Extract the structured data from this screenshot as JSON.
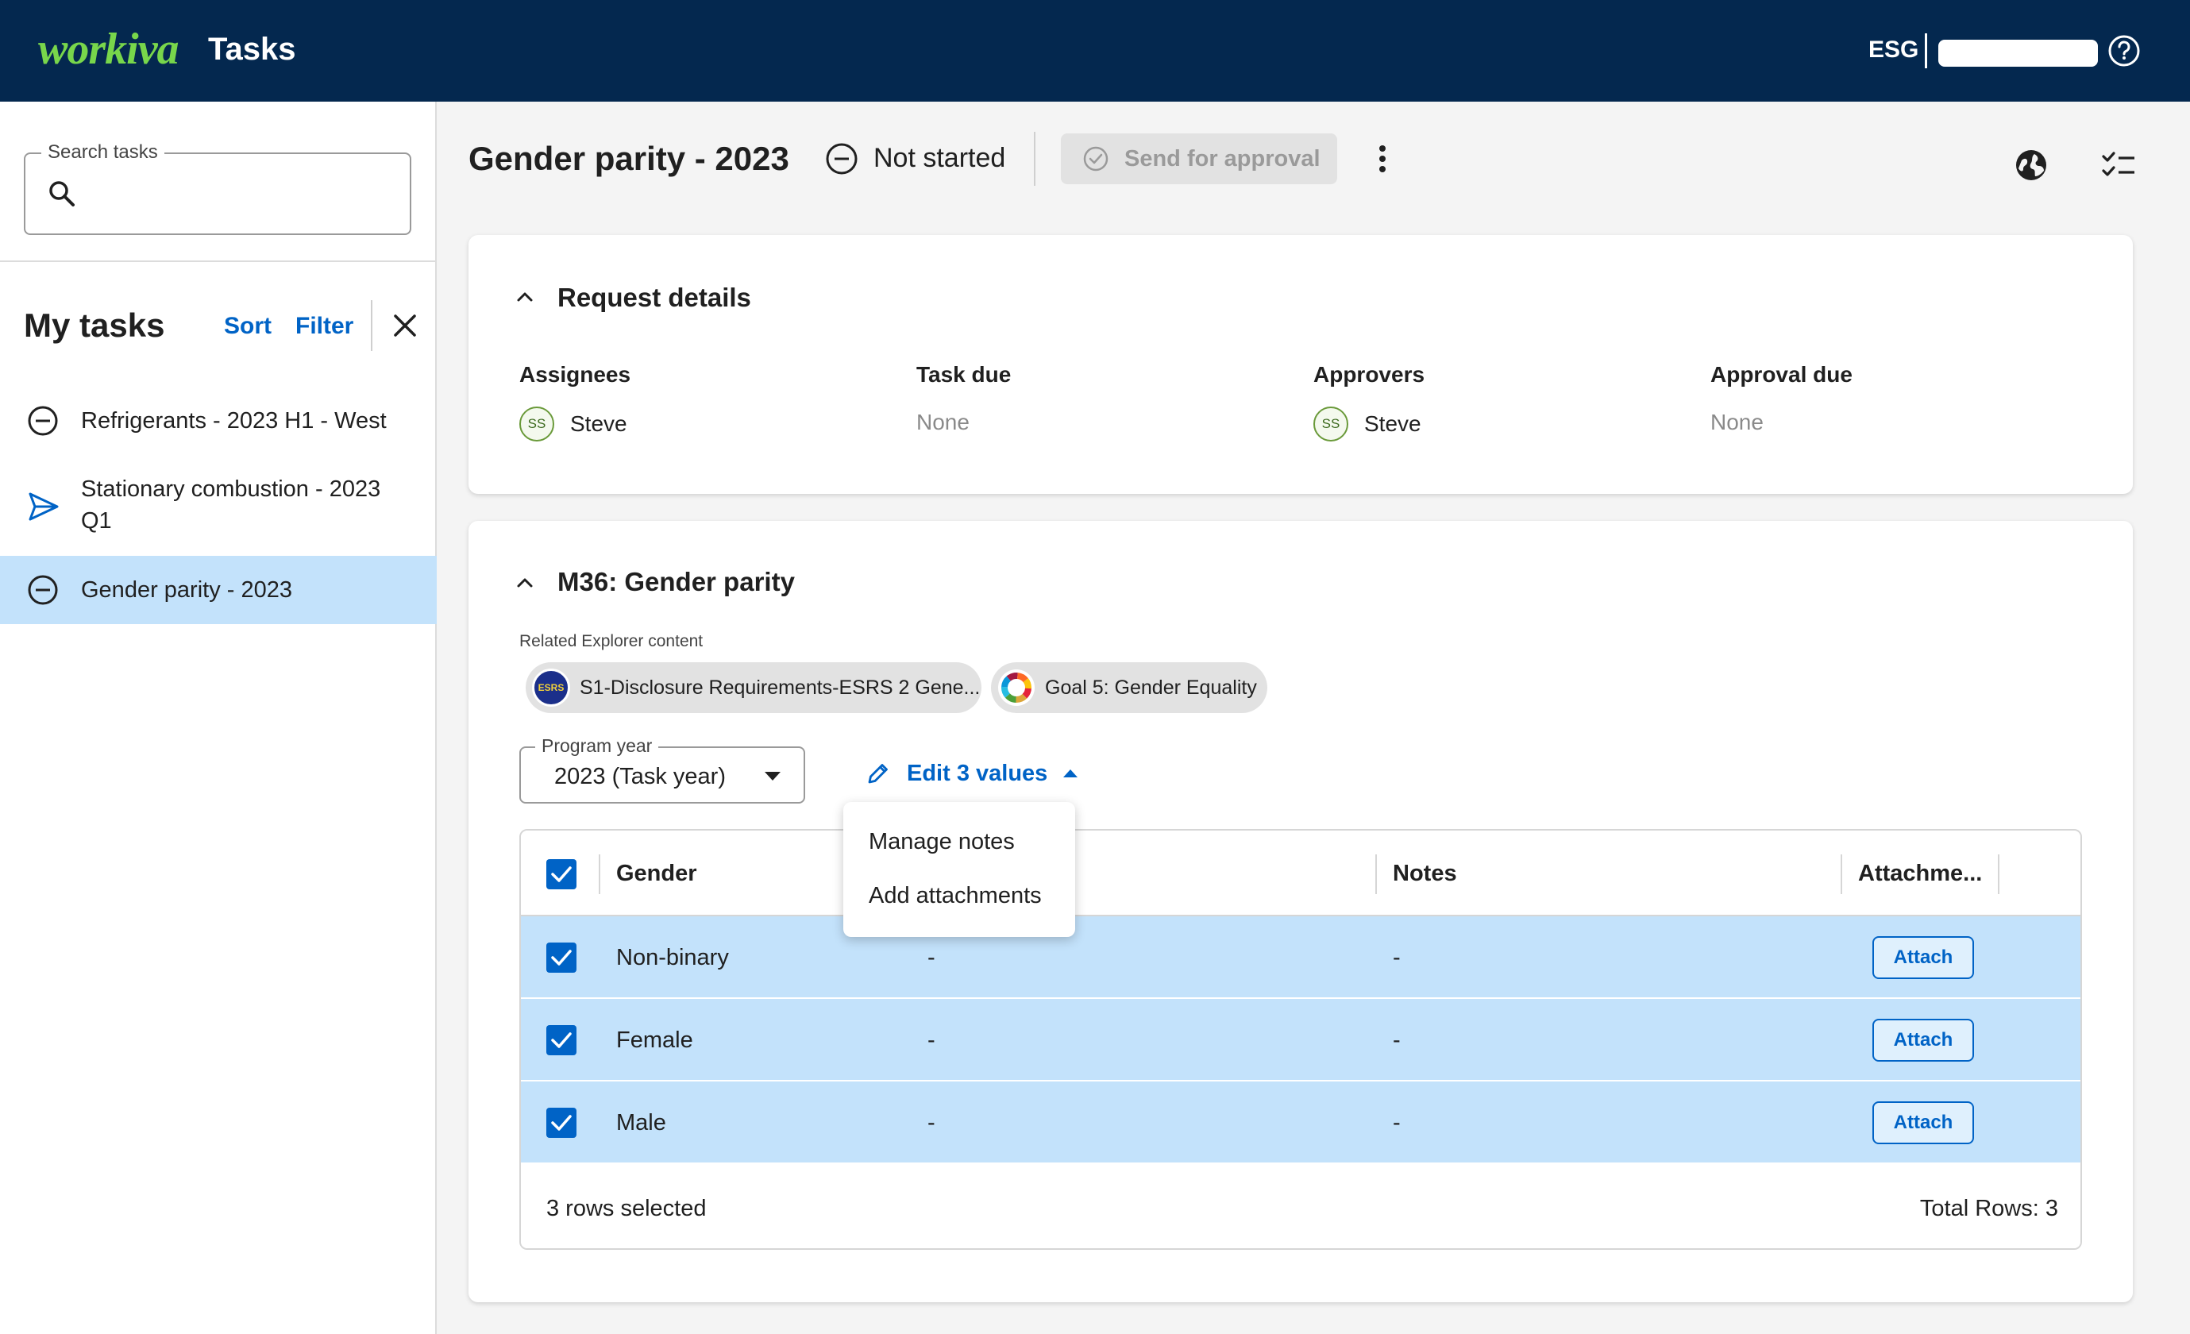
{
  "header": {
    "logo_text": "workiva",
    "app_title": "Tasks",
    "org_label": "ESG"
  },
  "sidebar": {
    "search": {
      "legend": "Search tasks",
      "value": ""
    },
    "title": "My tasks",
    "sort_label": "Sort",
    "filter_label": "Filter",
    "tasks": [
      {
        "label": "Refrigerants - 2023 H1 - West",
        "status": "not-started"
      },
      {
        "label": "Stationary combustion - 2023 Q1",
        "status": "sent"
      },
      {
        "label": "Gender parity - 2023",
        "status": "not-started",
        "active": true
      }
    ]
  },
  "task": {
    "title": "Gender parity - 2023",
    "status": "Not started",
    "send_button": "Send for approval"
  },
  "request_details": {
    "title": "Request details",
    "assignees_label": "Assignees",
    "assignee": {
      "initials": "SS",
      "name": "Steve"
    },
    "task_due_label": "Task due",
    "task_due_value": "None",
    "approvers_label": "Approvers",
    "approver": {
      "initials": "SS",
      "name": "Steve"
    },
    "approval_due_label": "Approval due",
    "approval_due_value": "None"
  },
  "metric": {
    "title": "M36: Gender parity",
    "related_label": "Related Explorer content",
    "chips": [
      {
        "label": "S1-Disclosure Requirements-ESRS 2 Gene...",
        "logo_text": "ESRS"
      },
      {
        "label": "Goal 5: Gender Equality"
      }
    ],
    "program_year_label": "Program year",
    "program_year_value": "2023 (Task year)",
    "edit_values_label": "Edit 3 values",
    "menu": [
      "Manage notes",
      "Add attachments"
    ],
    "grid": {
      "columns": [
        "Gender",
        "Notes",
        "Attachme..."
      ],
      "rows": [
        {
          "gender": "Non-binary",
          "value": "-",
          "notes": "-",
          "attach": "Attach"
        },
        {
          "gender": "Female",
          "value": "-",
          "notes": "-",
          "attach": "Attach"
        },
        {
          "gender": "Male",
          "value": "-",
          "notes": "-",
          "attach": "Attach"
        }
      ],
      "footer_left": "3 rows selected",
      "footer_right": "Total Rows: 3"
    }
  },
  "colors": {
    "topbar": "#04284f",
    "brand_green": "#78d64b",
    "accent_blue": "#0063c6",
    "selected_row": "#c3e2fb"
  }
}
